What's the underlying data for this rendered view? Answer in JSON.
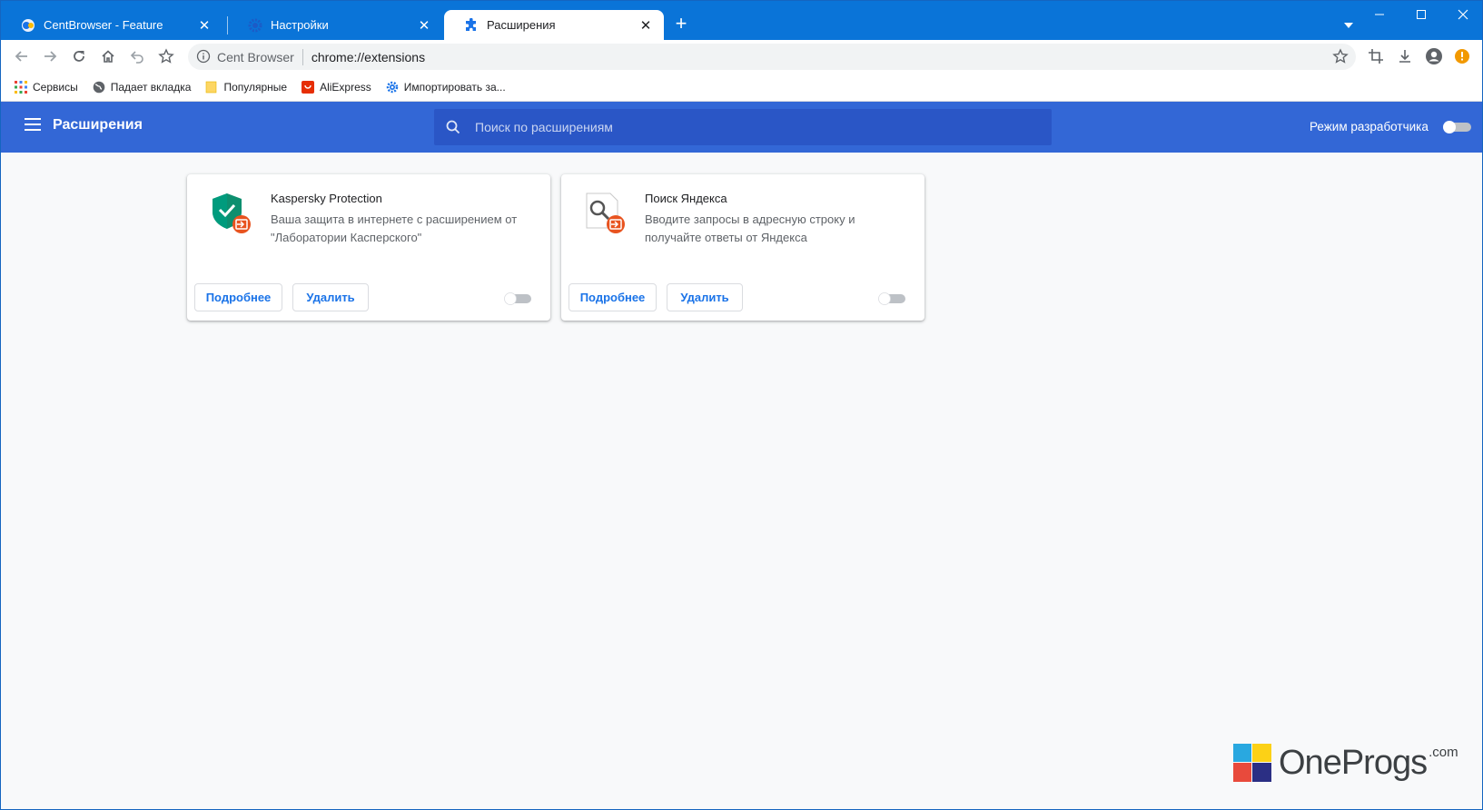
{
  "browser": {
    "tabs": [
      {
        "title": "CentBrowser - Feature",
        "active": false,
        "icon": "centbrowser-icon"
      },
      {
        "title": "Настройки",
        "active": false,
        "icon": "settings-gear-icon"
      },
      {
        "title": "Расширения",
        "active": true,
        "icon": "puzzle-icon"
      }
    ],
    "new_tab": "+",
    "address": {
      "site_chip": "Cent Browser",
      "url": "chrome://extensions"
    },
    "bookmarks": [
      {
        "label": "Сервисы",
        "icon": "apps-grid-icon"
      },
      {
        "label": "Падает вкладка",
        "icon": "globe-icon"
      },
      {
        "label": "Популярные",
        "icon": "folder-icon"
      },
      {
        "label": "AliExpress",
        "icon": "aliexpress-icon"
      },
      {
        "label": "Импортировать за...",
        "icon": "gear-icon"
      }
    ],
    "accent": "#0a74d8"
  },
  "extensions_page": {
    "title": "Расширения",
    "search_placeholder": "Поиск по расширениям",
    "dev_mode_label": "Режим разработчика",
    "dev_mode_enabled": false,
    "header_color": "#3367d6",
    "cards": [
      {
        "name": "Kaspersky Protection",
        "description": "Ваша защита в интернете с расширением от \"Лаборатории Касперского\"",
        "details_label": "Подробнее",
        "remove_label": "Удалить",
        "enabled": false
      },
      {
        "name": "Поиск Яндекса",
        "description": "Вводите запросы в адресную строку и получайте ответы от Яндекса",
        "details_label": "Подробнее",
        "remove_label": "Удалить",
        "enabled": false
      }
    ]
  },
  "watermark": {
    "text": "OneProgs",
    "suffix": ".com"
  }
}
